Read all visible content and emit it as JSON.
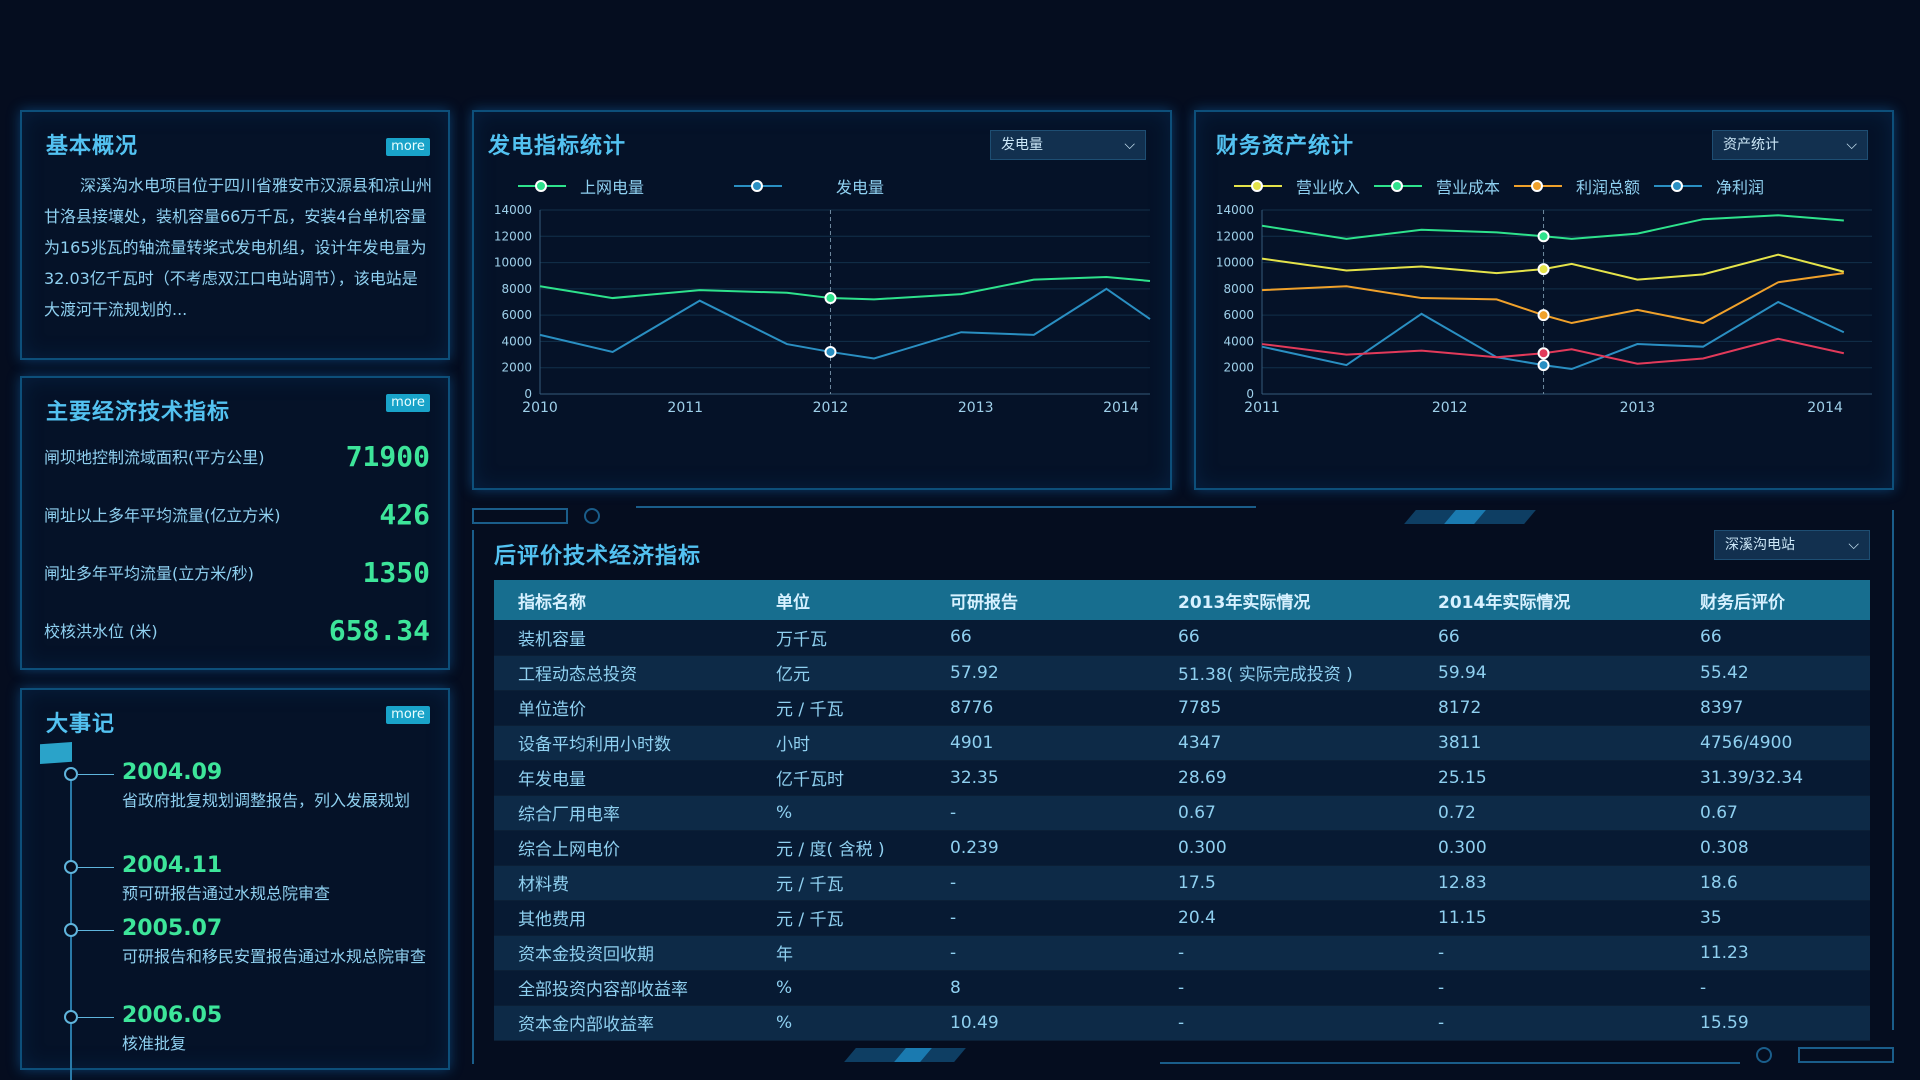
{
  "overview": {
    "title": "基本概况",
    "more": "more",
    "text": "深溪沟水电项目位于四川省雅安市汉源县和凉山州甘洛县接壤处，装机容量66万千瓦，安装4台单机容量为165兆瓦的轴流量转桨式发电机组，设计年发电量为32.03亿千瓦时（不考虑双江口电站调节），该电站是大渡河干流规划的..."
  },
  "indicators": {
    "title": "主要经济技术指标",
    "more": "more",
    "items": [
      {
        "label": "闸坝地控制流域面积(平方公里)",
        "value": "71900"
      },
      {
        "label": "闸址以上多年平均流量(亿立方米)",
        "value": "426"
      },
      {
        "label": "闸址多年平均流量(立方米/秒)",
        "value": "1350"
      },
      {
        "label": "校核洪水位 (米)",
        "value": "658.34"
      }
    ]
  },
  "events": {
    "title": "大事记",
    "more": "more",
    "items": [
      {
        "date": "2004.09",
        "desc": "省政府批复规划调整报告，列入发展规划"
      },
      {
        "date": "2004.11",
        "desc": "预可研报告通过水规总院审查"
      },
      {
        "date": "2005.07",
        "desc": "可研报告和移民安置报告通过水规总院审查"
      },
      {
        "date": "2006.05",
        "desc": "核准批复"
      }
    ]
  },
  "power_panel": {
    "title": "发电指标统计",
    "dropdown": "发电量",
    "chart_data": {
      "type": "line",
      "x_ticks": [
        "2010",
        "2011",
        "2012",
        "2013",
        "2014"
      ],
      "y_ticks": [
        0,
        2000,
        4000,
        6000,
        8000,
        10000,
        12000,
        14000
      ],
      "ylim": [
        0,
        14000
      ],
      "x_range": [
        2010,
        2014.2
      ],
      "series": [
        {
          "name": "上网电量",
          "color": "#2ee28c",
          "points": [
            [
              2010,
              8200
            ],
            [
              2010.5,
              7300
            ],
            [
              2011.1,
              7900
            ],
            [
              2011.7,
              7700
            ],
            [
              2012,
              7300
            ],
            [
              2012.3,
              7200
            ],
            [
              2012.9,
              7600
            ],
            [
              2013.4,
              8700
            ],
            [
              2013.9,
              8900
            ],
            [
              2014.2,
              8600
            ]
          ]
        },
        {
          "name": "发电量",
          "color": "#2a8fc2",
          "points": [
            [
              2010,
              4500
            ],
            [
              2010.5,
              3200
            ],
            [
              2011.1,
              7100
            ],
            [
              2011.7,
              3800
            ],
            [
              2012,
              3200
            ],
            [
              2012.3,
              2700
            ],
            [
              2012.9,
              4700
            ],
            [
              2013.4,
              4500
            ],
            [
              2013.9,
              8000
            ],
            [
              2014.2,
              5700
            ]
          ]
        }
      ],
      "marker_x": 2012
    }
  },
  "finance_panel": {
    "title": "财务资产统计",
    "dropdown": "资产统计",
    "chart_data": {
      "type": "line",
      "x_ticks": [
        "2011",
        "2012",
        "2013",
        "2014"
      ],
      "y_ticks": [
        0,
        2000,
        4000,
        6000,
        8000,
        10000,
        12000,
        14000
      ],
      "ylim": [
        0,
        14000
      ],
      "x_range": [
        2011,
        2014.25
      ],
      "series": [
        {
          "name": "营业收入",
          "color": "#e5e34a",
          "points": [
            [
              2011,
              10300
            ],
            [
              2011.45,
              9400
            ],
            [
              2011.85,
              9700
            ],
            [
              2012.25,
              9200
            ],
            [
              2012.5,
              9500
            ],
            [
              2012.65,
              9900
            ],
            [
              2013,
              8700
            ],
            [
              2013.35,
              9100
            ],
            [
              2013.75,
              10600
            ],
            [
              2014.1,
              9300
            ]
          ]
        },
        {
          "name": "营业成本",
          "color": "#2ee28c",
          "points": [
            [
              2011,
              12800
            ],
            [
              2011.45,
              11800
            ],
            [
              2011.85,
              12500
            ],
            [
              2012.25,
              12300
            ],
            [
              2012.5,
              12000
            ],
            [
              2012.65,
              11800
            ],
            [
              2013,
              12200
            ],
            [
              2013.35,
              13300
            ],
            [
              2013.75,
              13600
            ],
            [
              2014.1,
              13200
            ]
          ]
        },
        {
          "name": "利润总额",
          "color": "#f0a12b",
          "points": [
            [
              2011,
              7900
            ],
            [
              2011.45,
              8200
            ],
            [
              2011.85,
              7300
            ],
            [
              2012.25,
              7200
            ],
            [
              2012.5,
              6000
            ],
            [
              2012.65,
              5400
            ],
            [
              2013,
              6400
            ],
            [
              2013.35,
              5400
            ],
            [
              2013.75,
              8500
            ],
            [
              2014.1,
              9200
            ]
          ]
        },
        {
          "name": "净利润",
          "color": "#2a8fc2",
          "points": [
            [
              2011,
              3600
            ],
            [
              2011.45,
              2200
            ],
            [
              2011.85,
              6100
            ],
            [
              2012.25,
              2800
            ],
            [
              2012.5,
              2200
            ],
            [
              2012.65,
              1900
            ],
            [
              2013,
              3800
            ],
            [
              2013.35,
              3600
            ],
            [
              2013.75,
              7000
            ],
            [
              2014.1,
              4700
            ]
          ]
        },
        {
          "name": "",
          "color": "#e23a5a",
          "points": [
            [
              2011,
              3800
            ],
            [
              2011.45,
              3000
            ],
            [
              2011.85,
              3300
            ],
            [
              2012.25,
              2800
            ],
            [
              2012.5,
              3100
            ],
            [
              2012.65,
              3400
            ],
            [
              2013,
              2300
            ],
            [
              2013.35,
              2700
            ],
            [
              2013.75,
              4200
            ],
            [
              2014.1,
              3100
            ]
          ]
        }
      ],
      "marker_x": 2012.5
    }
  },
  "post_eval": {
    "title": "后评价技术经济指标",
    "dropdown": "深溪沟电站",
    "columns": [
      "指标名称",
      "单位",
      "可研报告",
      "2013年实际情况",
      "2014年实际情况",
      "财务后评价"
    ],
    "rows": [
      [
        "装机容量",
        "万千瓦",
        "66",
        "66",
        "66",
        "66"
      ],
      [
        "工程动态总投资",
        "亿元",
        "57.92",
        "51.38( 实际完成投资 )",
        "59.94",
        "55.42"
      ],
      [
        "单位造价",
        "元 / 千瓦",
        "8776",
        "7785",
        "8172",
        "8397"
      ],
      [
        "设备平均利用小时数",
        "小时",
        "4901",
        "4347",
        "3811",
        "4756/4900"
      ],
      [
        "年发电量",
        "亿千瓦时",
        "32.35",
        "28.69",
        "25.15",
        "31.39/32.34"
      ],
      [
        "综合厂用电率",
        "%",
        "-",
        "0.67",
        "0.72",
        "0.67"
      ],
      [
        "综合上网电价",
        "元 / 度( 含税 )",
        "0.239",
        "0.300",
        "0.300",
        "0.308"
      ],
      [
        "材料费",
        "元 / 千瓦",
        "-",
        "17.5",
        "12.83",
        "18.6"
      ],
      [
        "其他费用",
        "元 / 千瓦",
        "-",
        "20.4",
        "11.15",
        "35"
      ],
      [
        "资本金投资回收期",
        "年",
        "-",
        "-",
        "-",
        "11.23"
      ],
      [
        "全部投资内容部收益率",
        "%",
        "8",
        "-",
        "-",
        "-"
      ],
      [
        "资本金内部收益率",
        "%",
        "10.49",
        "-",
        "-",
        "15.59"
      ]
    ]
  }
}
